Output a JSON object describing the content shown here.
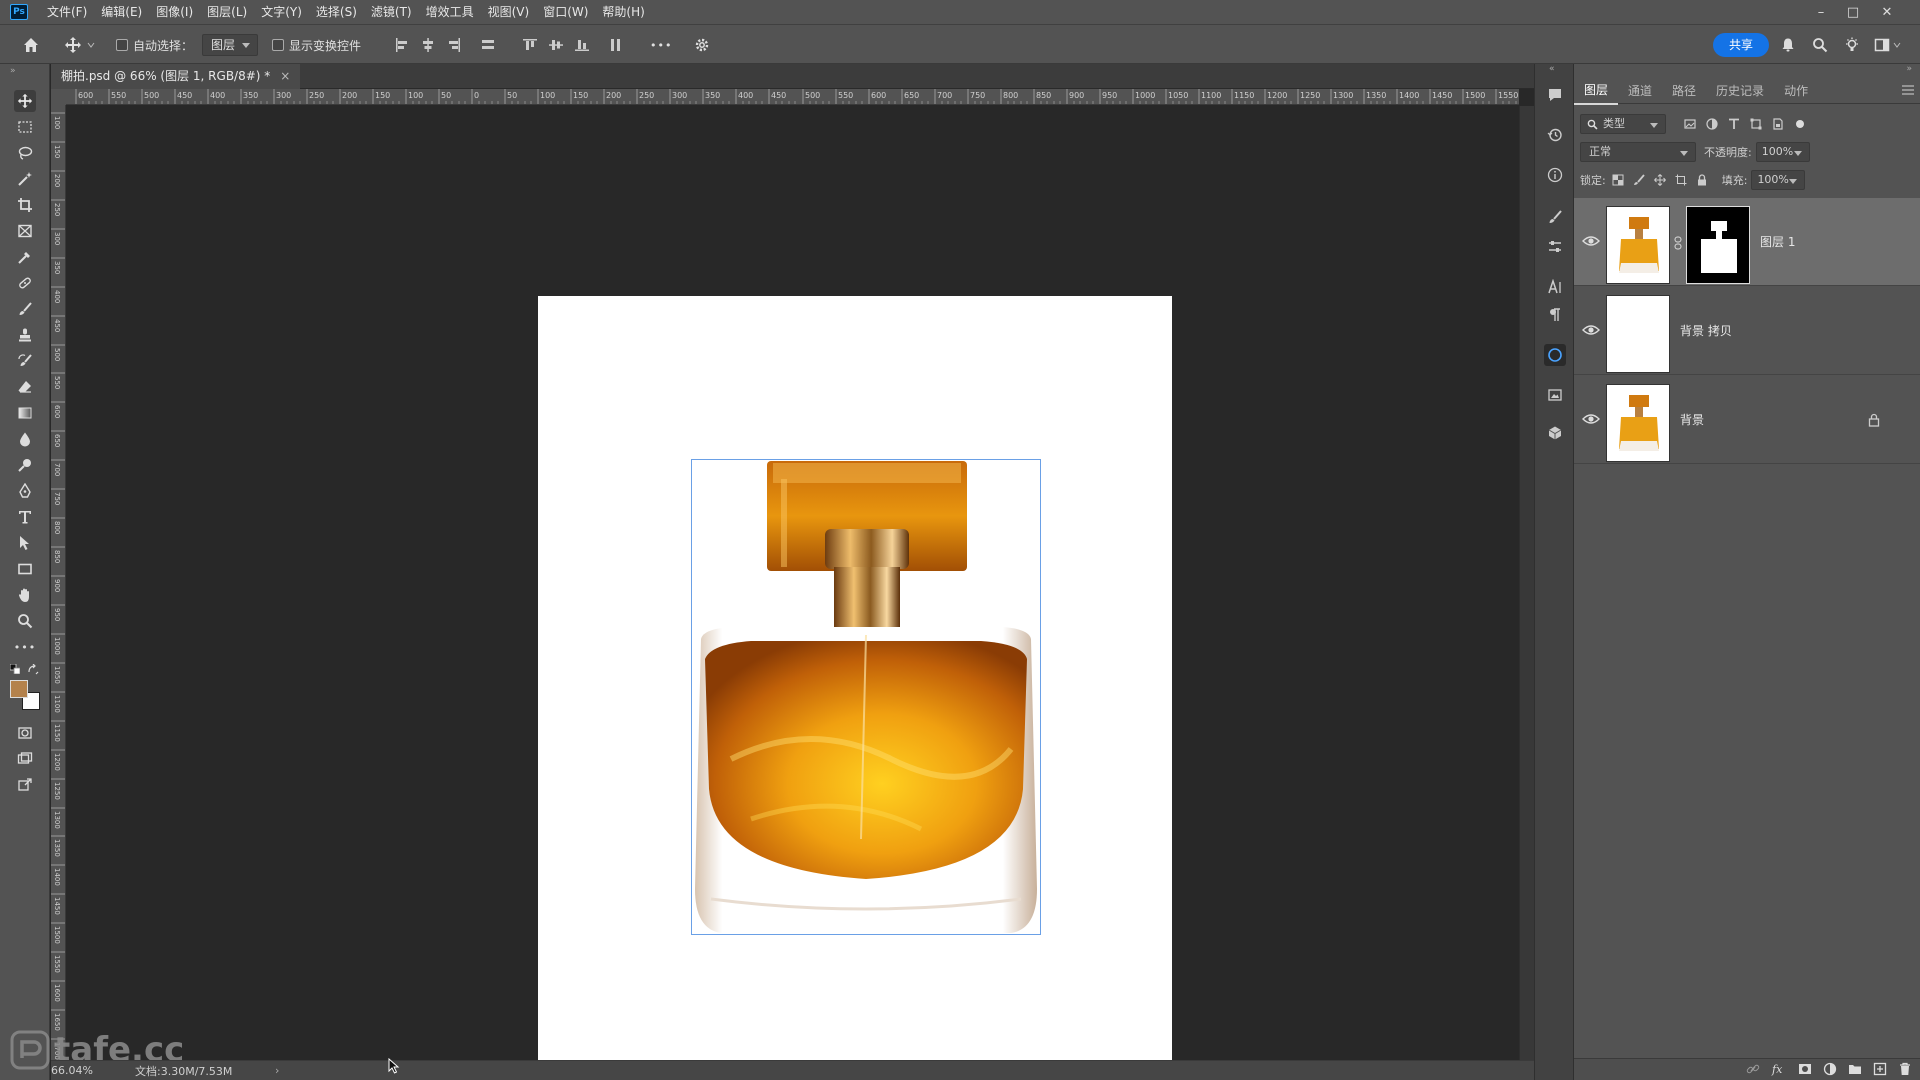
{
  "app": {
    "logo": "Ps"
  },
  "menu": [
    "文件(F)",
    "编辑(E)",
    "图像(I)",
    "图层(L)",
    "文字(Y)",
    "选择(S)",
    "滤镜(T)",
    "增效工具",
    "视图(V)",
    "窗口(W)",
    "帮助(H)"
  ],
  "window_controls": {
    "minimize": "–",
    "maximize": "□",
    "close": "✕"
  },
  "options": {
    "auto_select_label": "自动选择：",
    "auto_select_value": "图层",
    "show_transform_label": "显示变换控件",
    "more_label": "•••",
    "share_label": "共享"
  },
  "document": {
    "tab_title": "棚拍.psd @ 66% (图层 1, RGB/8#) *",
    "close": "×"
  },
  "rulers": {
    "top_labels": [
      "600",
      "550",
      "500",
      "450",
      "400",
      "350",
      "300",
      "250",
      "200",
      "150",
      "100",
      "50",
      "0",
      "50",
      "100",
      "150",
      "200",
      "250",
      "300",
      "350",
      "400",
      "450",
      "500",
      "550",
      "600",
      "650",
      "700",
      "750",
      "800",
      "850",
      "900",
      "950",
      "1000",
      "1050",
      "1100",
      "1150",
      "1200",
      "1250",
      "1300",
      "1350",
      "1400",
      "1450",
      "1500",
      "1550"
    ],
    "left_labels": [
      "100",
      "150",
      "200",
      "250",
      "300",
      "350",
      "400",
      "450",
      "500",
      "550",
      "600",
      "650",
      "700",
      "750",
      "800",
      "850",
      "900",
      "950",
      "1000",
      "1050",
      "1100",
      "1150",
      "1200",
      "1250",
      "1300",
      "1350",
      "1400",
      "1450",
      "1500",
      "1550",
      "1600",
      "1650",
      "1700"
    ]
  },
  "status": {
    "zoom": "66.04%",
    "doc_info": "文档:3.30M/7.53M",
    "arrow": "›"
  },
  "watermark": "tafe.cc",
  "layers_panel": {
    "tabs": [
      "图层",
      "通道",
      "路径",
      "历史记录",
      "动作"
    ],
    "filter_label": "类型",
    "blend_mode": "正常",
    "opacity_label": "不透明度:",
    "opacity_value": "100%",
    "lock_label": "锁定:",
    "fill_label": "填充:",
    "fill_value": "100%",
    "layers": [
      {
        "name": "图层 1",
        "active": true,
        "has_mask": true
      },
      {
        "name": "背景 拷贝",
        "active": false,
        "has_mask": false
      },
      {
        "name": "背景",
        "active": false,
        "locked": true
      }
    ]
  },
  "colors": {
    "accent": "#1473e6",
    "panel": "#535353",
    "canvas_bg": "#282828"
  }
}
